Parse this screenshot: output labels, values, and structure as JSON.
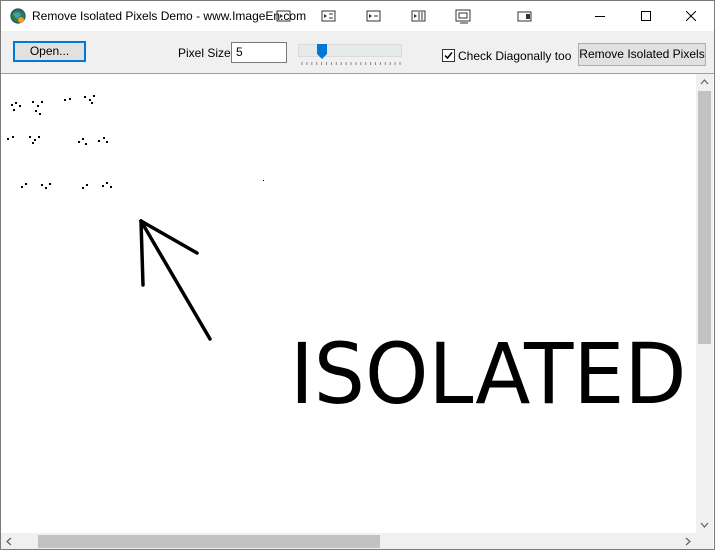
{
  "window": {
    "title": "Remove Isolated Pixels Demo - www.ImageEn.com",
    "title_icons": [
      "imageen-app-icon",
      "toolbar-icon-1",
      "toolbar-icon-2",
      "toolbar-icon-3",
      "toolbar-icon-4",
      "toolbar-icon-5",
      "toolbar-icon-6"
    ],
    "controls": [
      "minimize-icon",
      "maximize-icon",
      "close-icon"
    ]
  },
  "toolbar": {
    "open_label": "Open...",
    "pixel_size_label": "Pixel Size:",
    "pixel_size_value": "5",
    "pixel_size_slider_level": 0.2,
    "check_diagonally_label": "Check Diagonally too",
    "check_diagonally_checked": true,
    "remove_label": "Remove Isolated Pixels"
  },
  "image": {
    "text": "ISOLATED"
  },
  "colors": {
    "accent": "#0078d7",
    "toolbar_bg": "#f0f0f0",
    "button_bg": "#e1e1e1"
  }
}
